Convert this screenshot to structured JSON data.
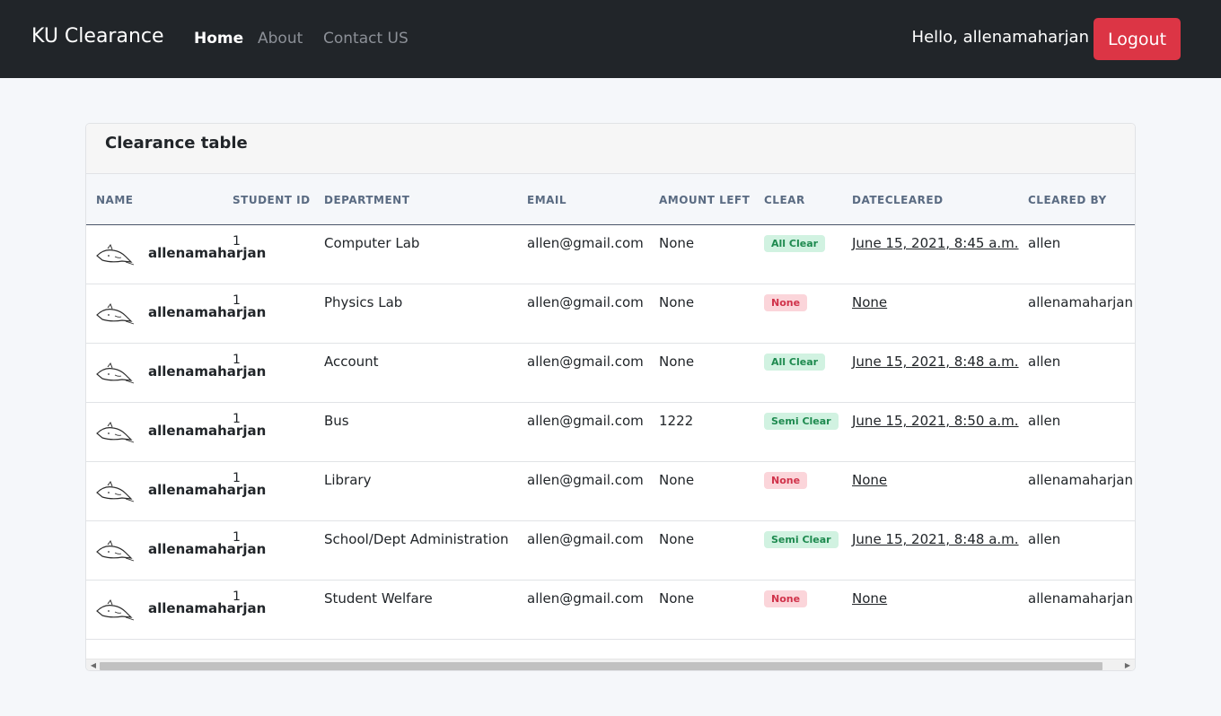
{
  "nav": {
    "brand": "KU Clearance",
    "links": [
      {
        "label": "Home",
        "active": true
      },
      {
        "label": "About",
        "active": false
      },
      {
        "label": "Contact US",
        "active": false
      }
    ],
    "greeting": "Hello, allenamaharjan",
    "logout_label": "Logout"
  },
  "card": {
    "title": "Clearance table",
    "columns": [
      "NAME",
      "STUDENT ID",
      "DEPARTMENT",
      "EMAIL",
      "AMOUNT LEFT",
      "CLEAR",
      "DATECLEARED",
      "CLEARED BY"
    ],
    "rows": [
      {
        "name": "allenamaharjan",
        "student_id": "1",
        "department": "Computer Lab",
        "email": "allen@gmail.com",
        "amount_left": "None",
        "clear": "All Clear",
        "date_cleared": "June 15, 2021, 8:45 a.m.",
        "cleared_by": "allen"
      },
      {
        "name": "allenamaharjan",
        "student_id": "1",
        "department": "Physics Lab",
        "email": "allen@gmail.com",
        "amount_left": "None",
        "clear": "None",
        "date_cleared": "None",
        "cleared_by": "allenamaharjan"
      },
      {
        "name": "allenamaharjan",
        "student_id": "1",
        "department": "Account",
        "email": "allen@gmail.com",
        "amount_left": "None",
        "clear": "All Clear",
        "date_cleared": "June 15, 2021, 8:48 a.m.",
        "cleared_by": "allen"
      },
      {
        "name": "allenamaharjan",
        "student_id": "1",
        "department": "Bus",
        "email": "allen@gmail.com",
        "amount_left": "1222",
        "clear": "Semi Clear",
        "date_cleared": "June 15, 2021, 8:50 a.m.",
        "cleared_by": "allen"
      },
      {
        "name": "allenamaharjan",
        "student_id": "1",
        "department": "Library",
        "email": "allen@gmail.com",
        "amount_left": "None",
        "clear": "None",
        "date_cleared": "None",
        "cleared_by": "allenamaharjan"
      },
      {
        "name": "allenamaharjan",
        "student_id": "1",
        "department": "School/Dept Administration",
        "email": "allen@gmail.com",
        "amount_left": "None",
        "clear": "Semi Clear",
        "date_cleared": "June 15, 2021, 8:48 a.m.",
        "cleared_by": "allen"
      },
      {
        "name": "allenamaharjan",
        "student_id": "1",
        "department": "Student Welfare",
        "email": "allen@gmail.com",
        "amount_left": "None",
        "clear": "None",
        "date_cleared": "None",
        "cleared_by": "allenamaharjan"
      }
    ]
  },
  "colors": {
    "navbar_bg": "#212529",
    "logout_bg": "#dc3545",
    "badge_all_clear": {
      "bg": "#d1f2e1",
      "fg": "#1e8a4f"
    },
    "badge_semi_clear": {
      "bg": "#d1f2e1",
      "fg": "#1e8a4f"
    },
    "badge_none": {
      "bg": "#fbd5da",
      "fg": "#d0324a"
    }
  },
  "icons": {
    "avatar": "whale-sketch-icon"
  }
}
